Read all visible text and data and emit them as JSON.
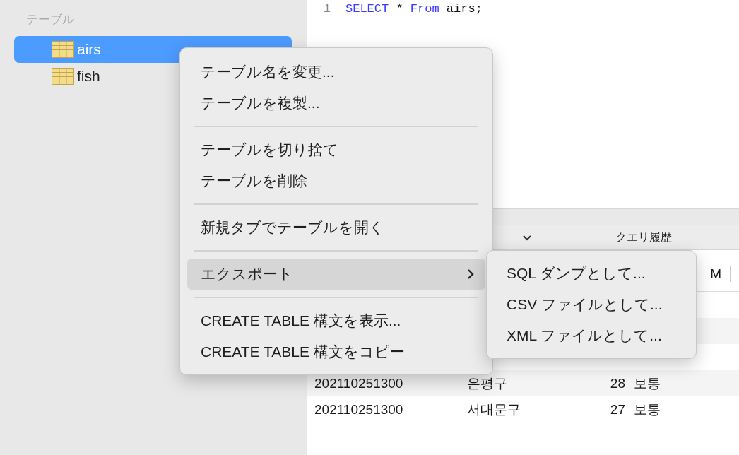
{
  "sidebar": {
    "heading": "テーブル",
    "items": [
      {
        "label": "airs",
        "selected": true
      },
      {
        "label": "fish",
        "selected": false
      }
    ]
  },
  "editor": {
    "lines": [
      {
        "number": "1",
        "tokens": [
          {
            "text": "SELECT",
            "kind": "keyword"
          },
          {
            "text": " * ",
            "kind": "plain"
          },
          {
            "text": "From",
            "kind": "keyword"
          },
          {
            "text": " airs;",
            "kind": "plain"
          }
        ]
      }
    ]
  },
  "results": {
    "tabs": [
      {
        "label": "クエリ履歴",
        "selected": false
      }
    ],
    "columns": [
      "M"
    ],
    "rows": [
      {
        "cells": [
          "",
          "",
          "",
          ""
        ]
      },
      {
        "cells": [
          "",
          "",
          "",
          ""
        ]
      },
      {
        "cells": [
          "",
          "",
          "",
          ""
        ]
      },
      {
        "cells": [
          "202110251300",
          "은평구",
          "28",
          "보통"
        ]
      },
      {
        "cells": [
          "202110251300",
          "서대문구",
          "27",
          "보통"
        ]
      }
    ]
  },
  "context_menu": {
    "groups": [
      [
        {
          "label": "テーブル名を変更...",
          "highlighted": false,
          "submenu": false
        },
        {
          "label": "テーブルを複製...",
          "highlighted": false,
          "submenu": false
        }
      ],
      [
        {
          "label": "テーブルを切り捨て",
          "highlighted": false,
          "submenu": false
        },
        {
          "label": "テーブルを削除",
          "highlighted": false,
          "submenu": false
        }
      ],
      [
        {
          "label": "新規タブでテーブルを開く",
          "highlighted": false,
          "submenu": false
        }
      ],
      [
        {
          "label": "エクスポート",
          "highlighted": true,
          "submenu": true
        }
      ],
      [
        {
          "label": "CREATE TABLE 構文を表示...",
          "highlighted": false,
          "submenu": false
        },
        {
          "label": "CREATE TABLE 構文をコピー",
          "highlighted": false,
          "submenu": false
        }
      ]
    ],
    "submenu": {
      "items": [
        "SQL ダンプとして...",
        "CSV ファイルとして...",
        "XML ファイルとして..."
      ]
    }
  }
}
